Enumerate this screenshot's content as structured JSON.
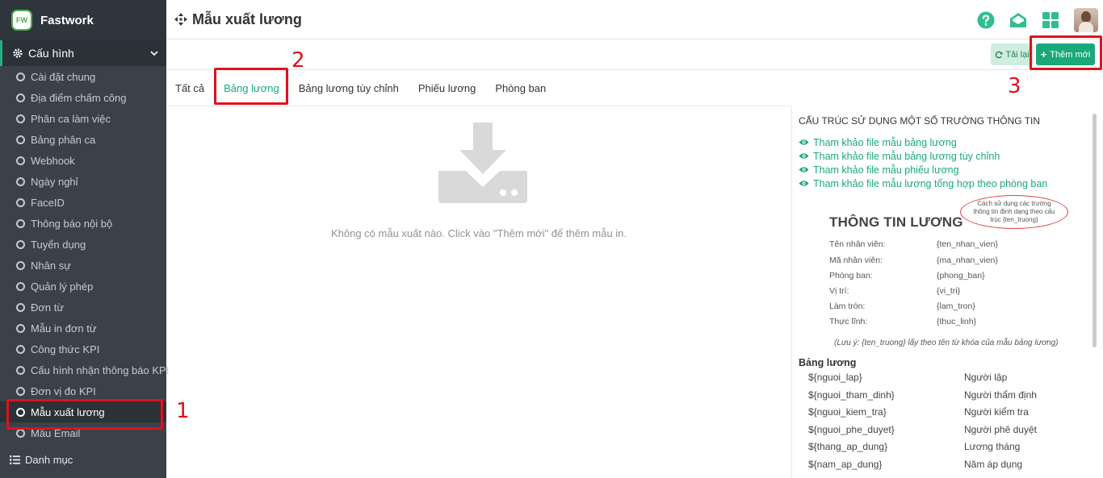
{
  "brand": {
    "name": "Fastwork",
    "logo_text": "FW"
  },
  "sidebar": {
    "section": "Cấu hình",
    "items": [
      {
        "label": "Cài đặt chung"
      },
      {
        "label": "Địa điểm chấm công"
      },
      {
        "label": "Phân ca làm việc"
      },
      {
        "label": "Bảng phân ca"
      },
      {
        "label": "Webhook"
      },
      {
        "label": "Ngày nghỉ"
      },
      {
        "label": "FaceID"
      },
      {
        "label": "Thông báo nội bộ"
      },
      {
        "label": "Tuyển dụng"
      },
      {
        "label": "Nhân sự"
      },
      {
        "label": "Quản lý phép"
      },
      {
        "label": "Đơn từ"
      },
      {
        "label": "Mẫu in đơn từ"
      },
      {
        "label": "Công thức KPI"
      },
      {
        "label": "Cấu hình nhận thông báo KPI"
      },
      {
        "label": "Đơn vị đo KPI"
      },
      {
        "label": "Mẫu xuất lương",
        "active": true
      },
      {
        "label": "Mẫu Email"
      }
    ],
    "bottom_section": "Danh mục"
  },
  "header": {
    "title": "Mẫu xuất lương",
    "icons": [
      "help-icon",
      "mail-open-icon",
      "apps-grid-icon",
      "avatar"
    ]
  },
  "toolbar": {
    "reload_label": "Tải lại",
    "add_label": "Thêm mới"
  },
  "tabs": [
    {
      "label": "Tất cả"
    },
    {
      "label": "Bảng lương",
      "active": true
    },
    {
      "label": "Bảng lương tùy chỉnh"
    },
    {
      "label": "Phiếu lương"
    },
    {
      "label": "Phòng ban"
    }
  ],
  "empty_state": {
    "text": "Không có mẫu xuất nào. Click vào \"Thêm mới\" để thêm mẫu in."
  },
  "info_panel": {
    "title": "CẤU TRÚC SỬ DỤNG MỘT SỐ TRƯỜNG THÔNG TIN",
    "links": [
      "Tham khảo file mẫu bảng lương",
      "Tham khảo file mẫu bảng lương tùy chỉnh",
      "Tham khảo file mẫu phiếu lương",
      "Tham khảo file mẫu lương tổng hợp theo phòng ban"
    ],
    "sample": {
      "title": "THÔNG TIN LƯƠNG",
      "bubble": "Cách sử dụng các trường thông tin định dạng theo cấu trúc {ten_truong}",
      "rows": [
        {
          "k": "Tên nhân viên:",
          "v": "{ten_nhan_vien}"
        },
        {
          "k": "Mã nhân viên:",
          "v": "{ma_nhan_vien}"
        },
        {
          "k": "Phòng ban:",
          "v": "{phong_ban}"
        },
        {
          "k": "Vị trí:",
          "v": "{vi_tri}"
        },
        {
          "k": "Làm tròn:",
          "v": "{lam_tron}"
        },
        {
          "k": "Thực lĩnh:",
          "v": "{thuc_linh}"
        }
      ],
      "note": "(Lưu ý: {ten_truong} lấy theo tên từ khóa của mẫu bảng lương)"
    },
    "bang_luong_title": "Bảng lương",
    "bang_luong_rows": [
      {
        "k": "${nguoi_lap}",
        "v": "Người lập"
      },
      {
        "k": "${nguoi_tham_dinh}",
        "v": "Người thẩm định"
      },
      {
        "k": "${nguoi_kiem_tra}",
        "v": "Người kiểm tra"
      },
      {
        "k": "${nguoi_phe_duyet}",
        "v": "Người phê duyệt"
      },
      {
        "k": "${thang_ap_dung}",
        "v": "Lương tháng"
      },
      {
        "k": "${nam_ap_dung}",
        "v": "Năm áp dụng"
      }
    ]
  },
  "annotations": [
    {
      "label": "1"
    },
    {
      "label": "2"
    },
    {
      "label": "3"
    }
  ],
  "colors": {
    "accent": "#1aa97a",
    "sidebar_bg": "#3a4149",
    "annotation": "#e1101a"
  }
}
